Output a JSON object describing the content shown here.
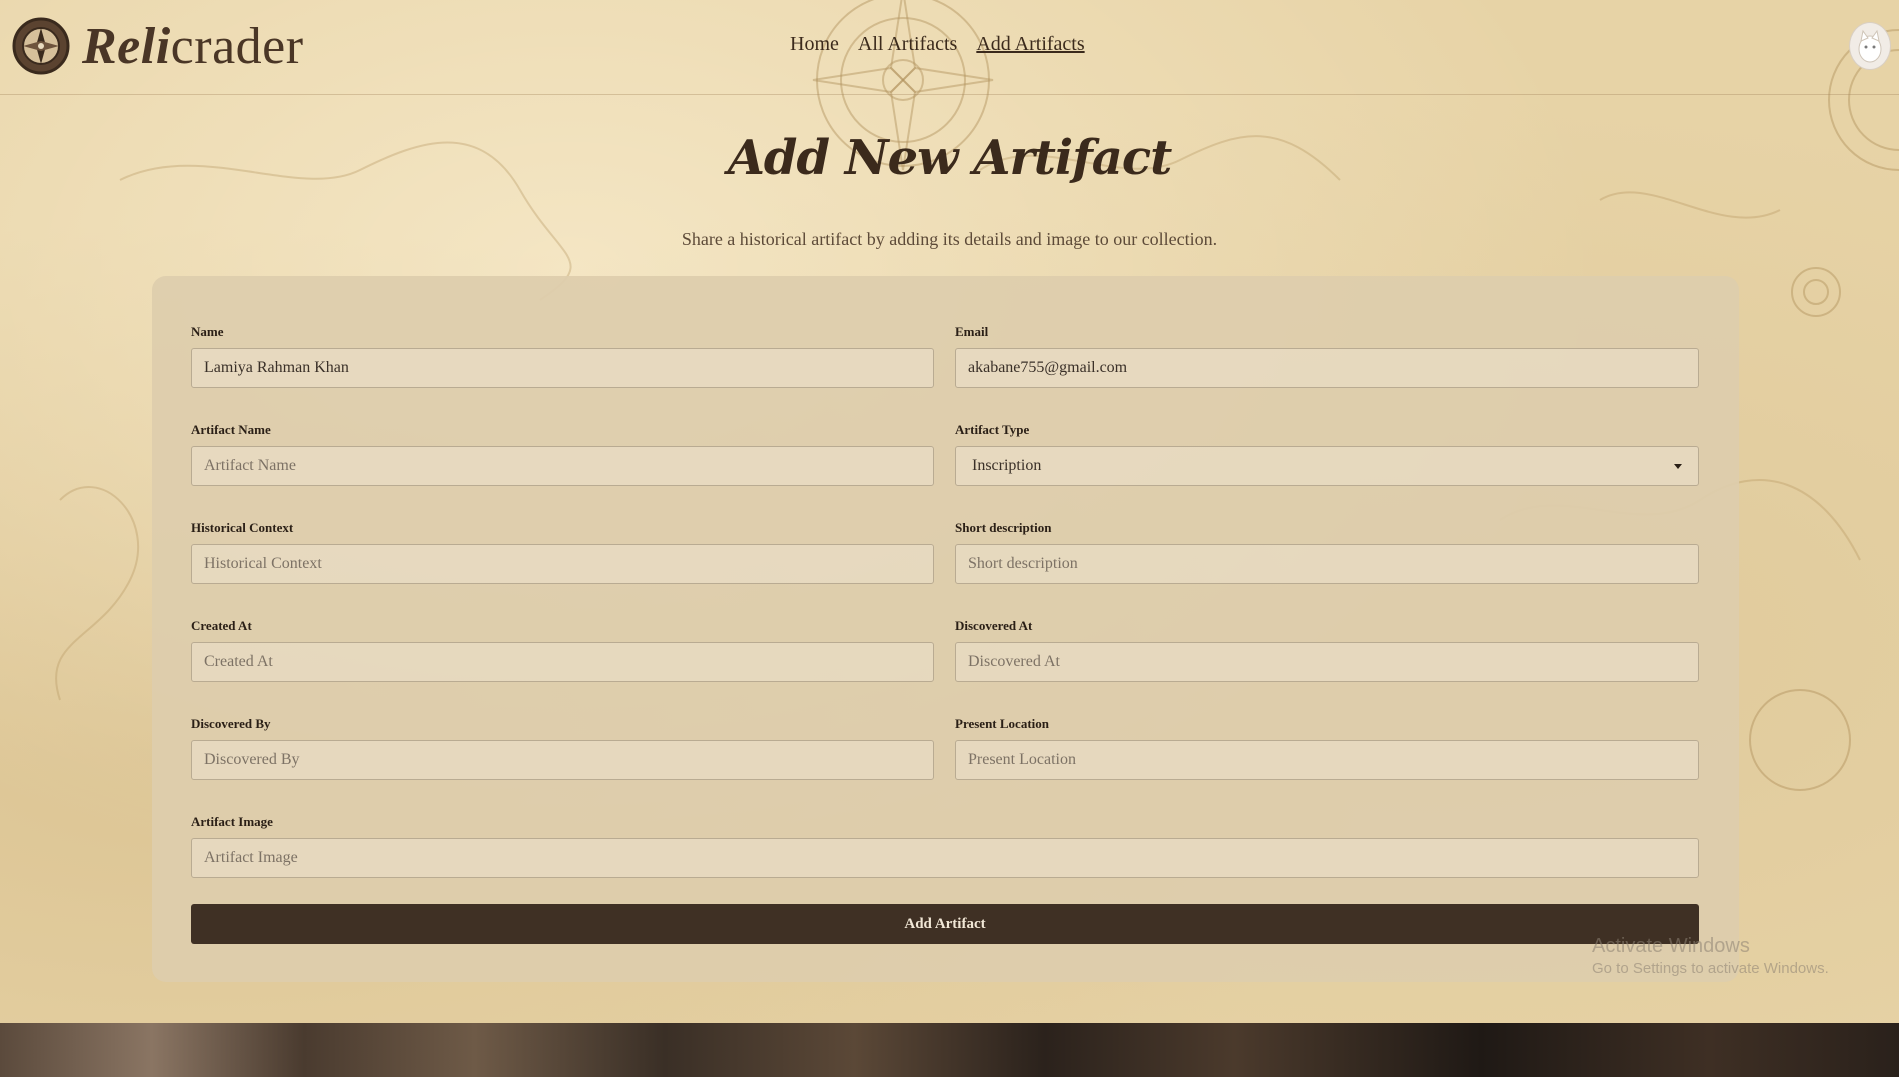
{
  "brand": {
    "logo_strong": "Reli",
    "logo_rest": "crader",
    "logo_icon": "compass-icon"
  },
  "nav": {
    "items": [
      {
        "label": "Home",
        "active": false
      },
      {
        "label": "All Artifacts",
        "active": false
      },
      {
        "label": "Add Artifacts",
        "active": true
      }
    ]
  },
  "user": {
    "avatar_icon": "user-avatar"
  },
  "page": {
    "title": "Add New Artifact",
    "subtitle": "Share a historical artifact by adding its details and image to our collection."
  },
  "form": {
    "name": {
      "label": "Name",
      "value": "Lamiya Rahman Khan"
    },
    "email": {
      "label": "Email",
      "value": "akabane755@gmail.com"
    },
    "artifact_name": {
      "label": "Artifact Name",
      "placeholder": "Artifact Name"
    },
    "artifact_type": {
      "label": "Artifact Type",
      "value": "Inscription"
    },
    "historical_context": {
      "label": "Historical Context",
      "placeholder": "Historical Context"
    },
    "short_description": {
      "label": "Short description",
      "placeholder": "Short description"
    },
    "created_at": {
      "label": "Created At",
      "placeholder": "Created At"
    },
    "discovered_at": {
      "label": "Discovered At",
      "placeholder": "Discovered At"
    },
    "discovered_by": {
      "label": "Discovered By",
      "placeholder": "Discovered By"
    },
    "present_location": {
      "label": "Present Location",
      "placeholder": "Present Location"
    },
    "artifact_image": {
      "label": "Artifact Image",
      "placeholder": "Artifact Image"
    },
    "submit_label": "Add Artifact"
  },
  "watermark": {
    "line1": "Activate Windows",
    "line2": "Go to Settings to activate Windows."
  },
  "colors": {
    "background": "#e7d3a6",
    "card": "#ddcdac",
    "button": "#3f3024",
    "text": "#3b2a1c"
  }
}
